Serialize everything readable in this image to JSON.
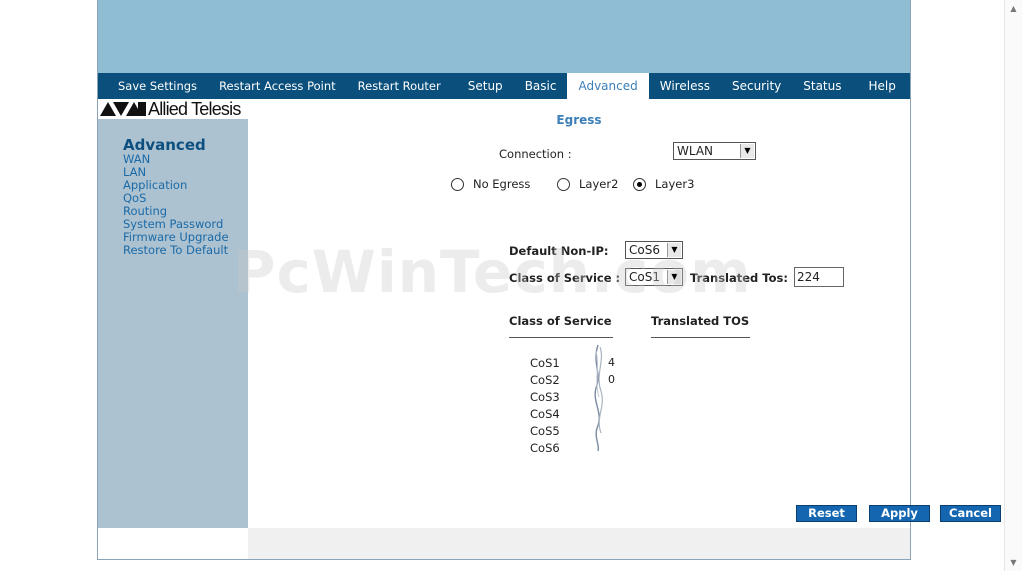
{
  "nav": {
    "items": [
      {
        "label": "Save Settings",
        "active": false
      },
      {
        "label": "Restart Access Point",
        "active": false
      },
      {
        "label": "Restart Router",
        "active": false
      },
      {
        "label": "Setup",
        "active": false
      },
      {
        "label": "Basic",
        "active": false
      },
      {
        "label": "Advanced",
        "active": true
      },
      {
        "label": "Wireless",
        "active": false
      },
      {
        "label": "Security",
        "active": false
      },
      {
        "label": "Status",
        "active": false
      },
      {
        "label": "Help",
        "active": false
      }
    ]
  },
  "brand": {
    "name": "Allied Telesis"
  },
  "sidebar": {
    "title": "Advanced",
    "items": [
      "WAN",
      "LAN",
      "Application",
      "QoS",
      "Routing",
      "System Password",
      "Firmware Upgrade",
      "Restore To Default"
    ]
  },
  "main": {
    "heading": "Egress",
    "connection_label": "Connection :",
    "connection_value": "WLAN",
    "radios": [
      {
        "label": "No Egress",
        "checked": false
      },
      {
        "label": "Layer2",
        "checked": false
      },
      {
        "label": "Layer3",
        "checked": true
      }
    ],
    "default_nonip_label": "Default Non-IP:",
    "default_nonip_value": "CoS6",
    "cos_label": "Class of Service :",
    "cos_value": "CoS1",
    "translated_tos_label": "Translated Tos:",
    "translated_tos_value": "224",
    "table": {
      "headers": [
        "Class of Service",
        "Translated TOS"
      ],
      "rows": [
        {
          "cos": "CoS1",
          "tos": "4"
        },
        {
          "cos": "CoS2",
          "tos": "0"
        },
        {
          "cos": "CoS3",
          "tos": ""
        },
        {
          "cos": "CoS4",
          "tos": ""
        },
        {
          "cos": "CoS5",
          "tos": ""
        },
        {
          "cos": "CoS6",
          "tos": ""
        }
      ]
    },
    "buttons": {
      "reset": "Reset",
      "apply": "Apply",
      "cancel": "Cancel"
    }
  },
  "watermark": "PcWinTech.com",
  "colors": {
    "nav_bg": "#0b4f7d",
    "banner": "#8ebdd4",
    "sidebar": "#adc2d0",
    "accent": "#3c7fb8",
    "button": "#1466b0"
  }
}
